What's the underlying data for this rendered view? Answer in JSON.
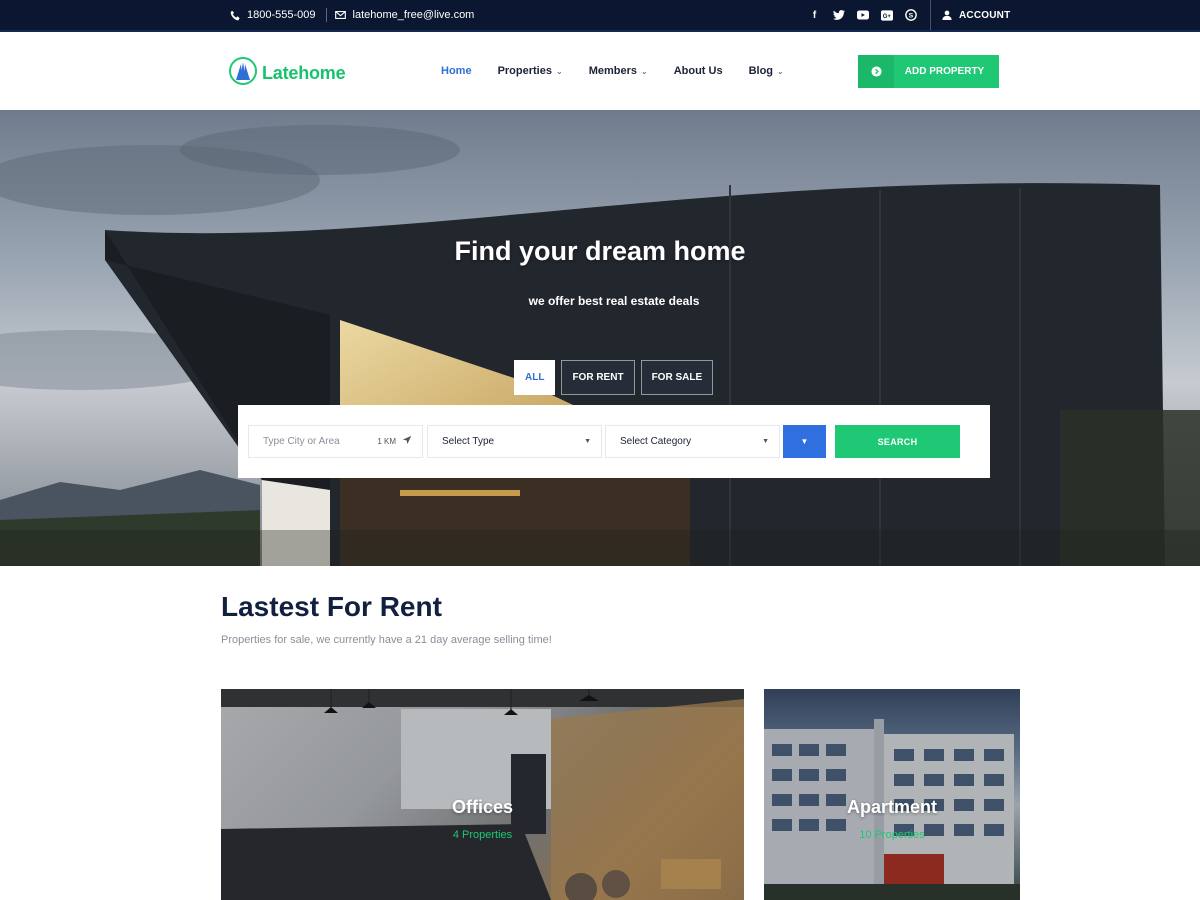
{
  "topbar": {
    "phone": "1800-555-009",
    "email": "latehome_free@live.com",
    "social_icons": [
      "facebook-icon",
      "twitter-icon",
      "youtube-icon",
      "google-plus-icon",
      "skype-icon"
    ],
    "account_label": "ACCOUNT"
  },
  "header": {
    "logo_text": "Latehome",
    "nav": [
      {
        "label": "Home",
        "active": true,
        "dropdown": false
      },
      {
        "label": "Properties",
        "active": false,
        "dropdown": true
      },
      {
        "label": "Members",
        "active": false,
        "dropdown": true
      },
      {
        "label": "About Us",
        "active": false,
        "dropdown": false
      },
      {
        "label": "Blog",
        "active": false,
        "dropdown": true
      }
    ],
    "add_property_label": "ADD PROPERTY"
  },
  "hero": {
    "title": "Find your dream home",
    "subtitle": "we offer best real estate deals",
    "tabs": [
      {
        "label": "ALL",
        "active": true
      },
      {
        "label": "FOR RENT",
        "active": false
      },
      {
        "label": "FOR SALE",
        "active": false
      }
    ],
    "search": {
      "city_placeholder": "Type City or Area",
      "radius": "1 KM",
      "type_value": "Select Type",
      "category_value": "Select Category",
      "search_label": "SEARCH"
    }
  },
  "section": {
    "title": "Lastest For Rent",
    "subtitle": "Properties for sale, we currently have a 21 day average selling time!"
  },
  "cards": [
    {
      "name": "Offices",
      "count": "4 Properties"
    },
    {
      "name": "Apartment",
      "count": "10 Properties"
    }
  ],
  "colors": {
    "accent_green": "#1ec874",
    "accent_blue": "#2f6fd6",
    "topbar_bg": "#0b1631",
    "heading": "#12203f"
  }
}
